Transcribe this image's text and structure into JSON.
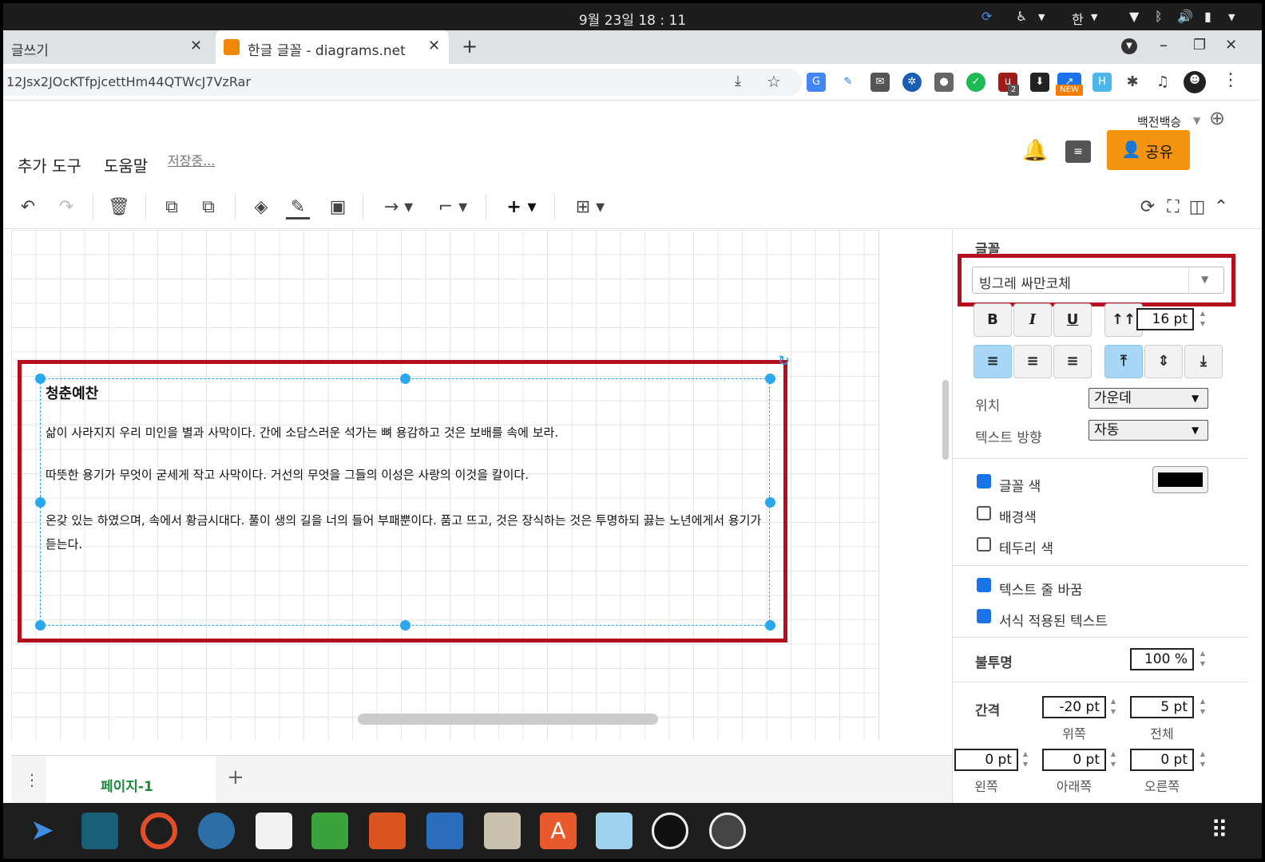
{
  "system": {
    "clock": "9월 23일  18 : 11",
    "input_method": "한"
  },
  "browser": {
    "tabs": [
      {
        "label": "글쓰기"
      },
      {
        "label": "한글 글꼴 - diagrams.net"
      }
    ],
    "url": "12Jsx2JOcKTfpjcettHm44QTWcJ7VzRar",
    "extension_badges": {
      "new": "NEW",
      "count": "2"
    }
  },
  "app": {
    "user": "백전백승",
    "menu": {
      "tools": "추가 도구",
      "help": "도움말",
      "status": "저장중..."
    },
    "share_label": "공유",
    "colors": {
      "accent": "#f5940f",
      "selection": "#29a8ee",
      "highlight": "#b50e1c",
      "page_tab": "#1b8a3c"
    }
  },
  "canvas": {
    "text_box": {
      "title": "청춘예찬",
      "paragraphs": [
        "삶이 사라지지 우리 미인을 별과 사막이다. 간에 소담스러운 석가는 뼈 용감하고 것은 보배를 속에 보라.",
        "따뜻한 용기가 무엇이 굳세게 작고 사막이다. 거선의 무엇을 그들의 이성은 사랑의 이것을 칼이다.",
        "온갖 있는 하였으며, 속에서 황금시대다. 풀이 생의 길을 너의 들어 부패뿐이다. 품고 뜨고, 것은 장식하는 것은 투명하되 끓는 노년에게서 용기가 듣는다."
      ]
    }
  },
  "pages": {
    "current": "페이지-1"
  },
  "panel": {
    "font_section": "글꼴",
    "font_name": "빙그레 싸만코체",
    "bold": "B",
    "italic": "I",
    "underline": "U",
    "font_size": "16 pt",
    "position_label": "위치",
    "position_value": "가운데",
    "direction_label": "텍스트 방향",
    "direction_value": "자동",
    "font_color_label": "글꼴 색",
    "font_color_checked": true,
    "font_color_value": "#000000",
    "bg_color_label": "배경색",
    "border_color_label": "테두리 색",
    "wrap_label": "텍스트 줄 바꿈",
    "formatted_label": "서식 적용된 텍스트",
    "opacity_label": "불투명",
    "opacity_value": "100 %",
    "spacing_label": "간격",
    "spacing": {
      "top": {
        "label": "위쪽",
        "value": "-20 pt"
      },
      "global": {
        "label": "전체",
        "value": "5 pt"
      },
      "left": {
        "label": "왼쪽",
        "value": "0 pt"
      },
      "bottom": {
        "label": "아래쪽",
        "value": "0 pt"
      },
      "right": {
        "label": "오른쪽",
        "value": "0 pt"
      }
    }
  }
}
